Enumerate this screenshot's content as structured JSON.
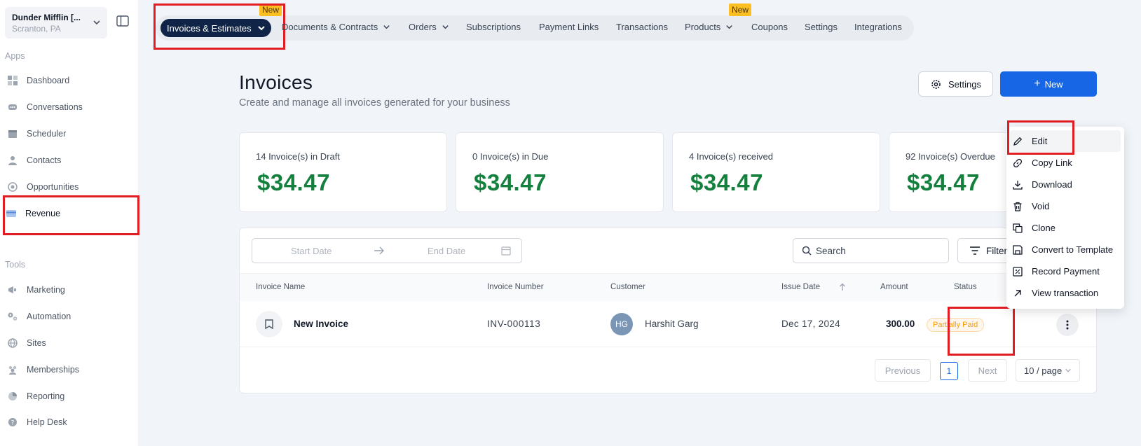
{
  "sidebar": {
    "location": {
      "name": "Dunder Mifflin [...",
      "address": "Scranton, PA"
    },
    "apps_title": "Apps",
    "apps": [
      {
        "label": "Dashboard",
        "icon": "dashboard-icon"
      },
      {
        "label": "Conversations",
        "icon": "chat-icon"
      },
      {
        "label": "Scheduler",
        "icon": "calendar-icon"
      },
      {
        "label": "Contacts",
        "icon": "user-icon"
      },
      {
        "label": "Opportunities",
        "icon": "target-icon"
      },
      {
        "label": "Revenue",
        "icon": "card-icon",
        "active": true
      }
    ],
    "tools_title": "Tools",
    "tools": [
      {
        "label": "Marketing",
        "icon": "megaphone-icon"
      },
      {
        "label": "Automation",
        "icon": "gears-icon"
      },
      {
        "label": "Sites",
        "icon": "globe-icon"
      },
      {
        "label": "Memberships",
        "icon": "people-icon"
      },
      {
        "label": "Reporting",
        "icon": "pie-icon"
      },
      {
        "label": "Help Desk",
        "icon": "help-icon"
      }
    ]
  },
  "topnav": {
    "active_tab": "Invoices & Estimates",
    "tabs": [
      {
        "label": "Documents & Contracts",
        "has_dropdown": true
      },
      {
        "label": "Orders",
        "has_dropdown": true
      },
      {
        "label": "Subscriptions"
      },
      {
        "label": "Payment Links"
      },
      {
        "label": "Transactions"
      },
      {
        "label": "Products",
        "has_dropdown": true,
        "badge": "New"
      },
      {
        "label": "Coupons"
      },
      {
        "label": "Settings"
      },
      {
        "label": "Integrations"
      }
    ],
    "new_badge": "New"
  },
  "header": {
    "title": "Invoices",
    "subtitle": "Create and manage all invoices generated for your business",
    "settings_label": "Settings",
    "new_label": "New"
  },
  "stats": [
    {
      "label": "14 Invoice(s) in Draft",
      "value": "$34.47"
    },
    {
      "label": "0 Invoice(s) in Due",
      "value": "$34.47"
    },
    {
      "label": "4 Invoice(s) received",
      "value": "$34.47"
    },
    {
      "label": "92 Invoice(s) Overdue",
      "value": "$34.47"
    }
  ],
  "filters": {
    "start_placeholder": "Start Date",
    "end_placeholder": "End Date",
    "search_placeholder": "Search",
    "filter_label": "Filter"
  },
  "table": {
    "columns": [
      "Invoice Name",
      "Invoice Number",
      "Customer",
      "Issue Date",
      "Amount",
      "Status"
    ],
    "rows": [
      {
        "name": "New Invoice",
        "number": "INV-000113",
        "customer_initials": "HG",
        "customer": "Harshit Garg",
        "issue_date": "Dec 17, 2024",
        "amount": "300.00",
        "status": "Partially Paid"
      }
    ]
  },
  "pagination": {
    "previous": "Previous",
    "current_page": "1",
    "next": "Next",
    "page_size": "10 / page"
  },
  "action_menu": [
    {
      "label": "Edit",
      "icon": "pencil-icon"
    },
    {
      "label": "Copy Link",
      "icon": "link-icon"
    },
    {
      "label": "Download",
      "icon": "download-icon"
    },
    {
      "label": "Void",
      "icon": "trash-icon"
    },
    {
      "label": "Clone",
      "icon": "copy-icon"
    },
    {
      "label": "Convert to Template",
      "icon": "save-icon"
    },
    {
      "label": "Record Payment",
      "icon": "receipt-icon"
    },
    {
      "label": "View transaction",
      "icon": "external-arrow-icon"
    }
  ],
  "colors": {
    "primary": "#1666e5",
    "active_tab_bg": "#0f2446",
    "amount_green": "#14803d",
    "highlight_red": "#e11d24",
    "badge_yellow": "#fbbf24"
  }
}
